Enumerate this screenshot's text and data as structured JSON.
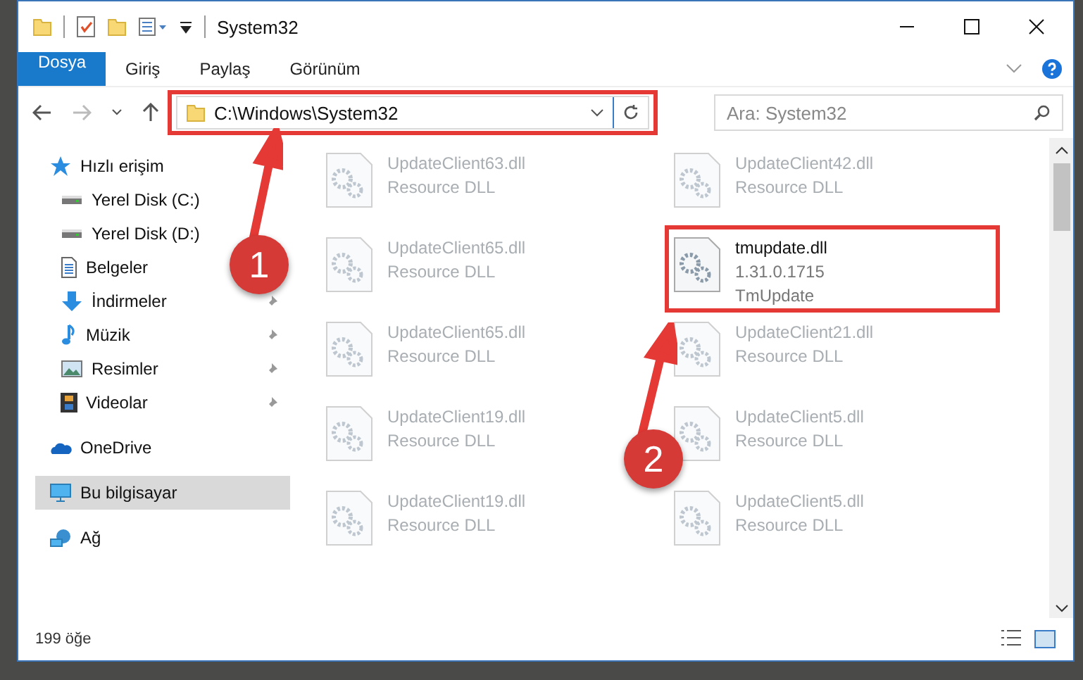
{
  "window": {
    "title": "System32"
  },
  "ribbon_tabs": [
    {
      "label": "Dosya",
      "kind": "file"
    },
    {
      "label": "Giriş",
      "kind": "tab"
    },
    {
      "label": "Paylaş",
      "kind": "tab"
    },
    {
      "label": "Görünüm",
      "kind": "tab"
    }
  ],
  "address_bar": {
    "path": "C:\\Windows\\System32"
  },
  "search": {
    "placeholder": "Ara: System32"
  },
  "sidebar": {
    "items": [
      {
        "label": "Hızlı erişim",
        "kind": "star",
        "pinned": false,
        "selected": false,
        "children": [
          {
            "label": "Yerel Disk (C:)",
            "kind": "drive",
            "pinned": false,
            "selected": false
          },
          {
            "label": "Yerel Disk (D:)",
            "kind": "drive",
            "pinned": false,
            "selected": false
          },
          {
            "label": "Belgeler",
            "kind": "document",
            "pinned": false,
            "selected": false
          },
          {
            "label": "İndirmeler",
            "kind": "download",
            "pinned": true,
            "selected": false
          },
          {
            "label": "Müzik",
            "kind": "music",
            "pinned": true,
            "selected": false
          },
          {
            "label": "Resimler",
            "kind": "picture",
            "pinned": true,
            "selected": false
          },
          {
            "label": "Videolar",
            "kind": "video",
            "pinned": true,
            "selected": false
          }
        ]
      },
      {
        "label": "OneDrive",
        "kind": "cloud",
        "pinned": false,
        "selected": false
      },
      {
        "label": "Bu bilgisayar",
        "kind": "computer",
        "pinned": false,
        "selected": true
      },
      {
        "label": "Ağ",
        "kind": "network",
        "pinned": false,
        "selected": false
      }
    ]
  },
  "files": [
    {
      "name": "UpdateClient63.dll",
      "details": [
        "Resource DLL"
      ],
      "dimmed": true,
      "highlighted": false
    },
    {
      "name": "UpdateClient42.dll",
      "details": [
        "Resource DLL"
      ],
      "dimmed": true,
      "highlighted": false
    },
    {
      "name": "UpdateClient65.dll",
      "details": [
        "Resource DLL"
      ],
      "dimmed": true,
      "highlighted": false
    },
    {
      "name": "tmupdate.dll",
      "details": [
        "1.31.0.1715",
        "TmUpdate"
      ],
      "dimmed": false,
      "highlighted": true
    },
    {
      "name": "UpdateClient65.dll",
      "details": [
        "Resource DLL"
      ],
      "dimmed": true,
      "highlighted": false
    },
    {
      "name": "UpdateClient21.dll",
      "details": [
        "Resource DLL"
      ],
      "dimmed": true,
      "highlighted": false
    },
    {
      "name": "UpdateClient19.dll",
      "details": [
        "Resource DLL"
      ],
      "dimmed": true,
      "highlighted": false
    },
    {
      "name": "UpdateClient5.dll",
      "details": [
        "Resource DLL"
      ],
      "dimmed": true,
      "highlighted": false
    },
    {
      "name": "UpdateClient19.dll",
      "details": [
        "Resource DLL"
      ],
      "dimmed": true,
      "highlighted": false
    },
    {
      "name": "UpdateClient5.dll",
      "details": [
        "Resource DLL"
      ],
      "dimmed": true,
      "highlighted": false
    }
  ],
  "annotations": [
    {
      "number": "1"
    },
    {
      "number": "2"
    }
  ],
  "status_bar": {
    "count": "199 öğe"
  }
}
